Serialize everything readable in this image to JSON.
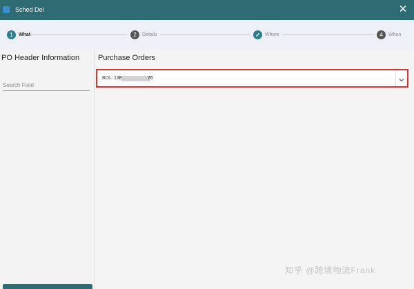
{
  "window": {
    "title": "Sched Del",
    "close_icon": "close-icon"
  },
  "stepper": {
    "steps": [
      {
        "number": "1",
        "label": "What",
        "state": "active"
      },
      {
        "number": "2",
        "label": "Details",
        "state": "inactive"
      },
      {
        "number": "",
        "label": "Where",
        "state": "active-edit",
        "icon": "pencil-icon"
      },
      {
        "number": "4",
        "label": "When",
        "state": "inactive"
      }
    ]
  },
  "left_panel": {
    "heading": "PO Header Information",
    "search_placeholder": "Search Field"
  },
  "right_panel": {
    "heading": "Purchase Orders",
    "select": {
      "label": "BOL:",
      "value_start": "13E",
      "value_end": "76",
      "dropdown_icon": "chevron-down-icon"
    }
  },
  "watermark": "知乎 @跨境物流Frank",
  "colors": {
    "titlebar": "#2e6b73",
    "accent": "#2e7f8c",
    "highlight_border": "#d9342f"
  }
}
